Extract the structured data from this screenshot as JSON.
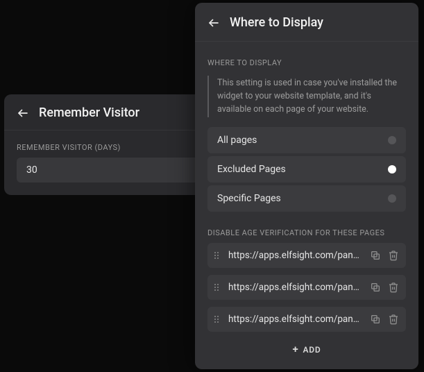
{
  "left": {
    "title": "Remember Visitor",
    "field_label": "REMEMBER VISITOR (DAYS)",
    "field_value": "30"
  },
  "right": {
    "title": "Where to Display",
    "section_label": "WHERE TO DISPLAY",
    "help_text": "This setting is used in case you've installed the widget to your website template, and it's available on each page of your website.",
    "options": {
      "all": "All pages",
      "excluded": "Excluded Pages",
      "specific": "Specific Pages"
    },
    "disable_label": "DISABLE AGE VERIFICATION FOR THESE PAGES",
    "urls": [
      "https://apps.elfsight.com/panel…",
      "https://apps.elfsight.com/panel…",
      "https://apps.elfsight.com/panel…"
    ],
    "add_label": "ADD"
  }
}
